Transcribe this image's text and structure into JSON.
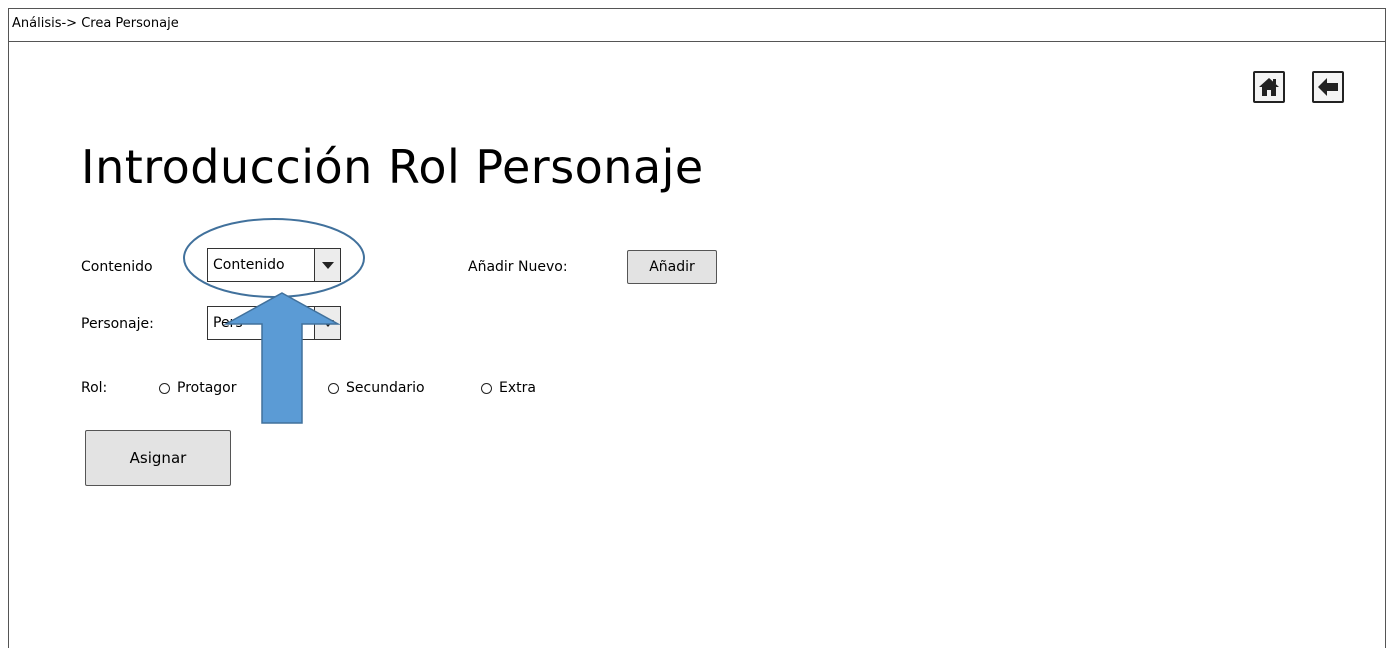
{
  "breadcrumb": "Análisis-> Crea Personaje",
  "header": {
    "home_icon": "home-icon",
    "back_icon": "arrow-left-icon"
  },
  "title": "Introducción Rol Personaje",
  "form": {
    "contenido_label": "Contenido",
    "contenido_value": "Contenido",
    "anadir_label": "Añadir Nuevo:",
    "anadir_button": "Añadir",
    "personaje_label": "Personaje:",
    "personaje_value": "Pers",
    "rol_label": "Rol:",
    "rol_options": [
      "Protagor",
      "Secundario",
      "Extra"
    ],
    "asignar_button": "Asignar"
  },
  "annotation": {
    "highlight_color": "#41719c",
    "arrow_fill": "#5b9bd5",
    "arrow_stroke": "#41719c"
  }
}
